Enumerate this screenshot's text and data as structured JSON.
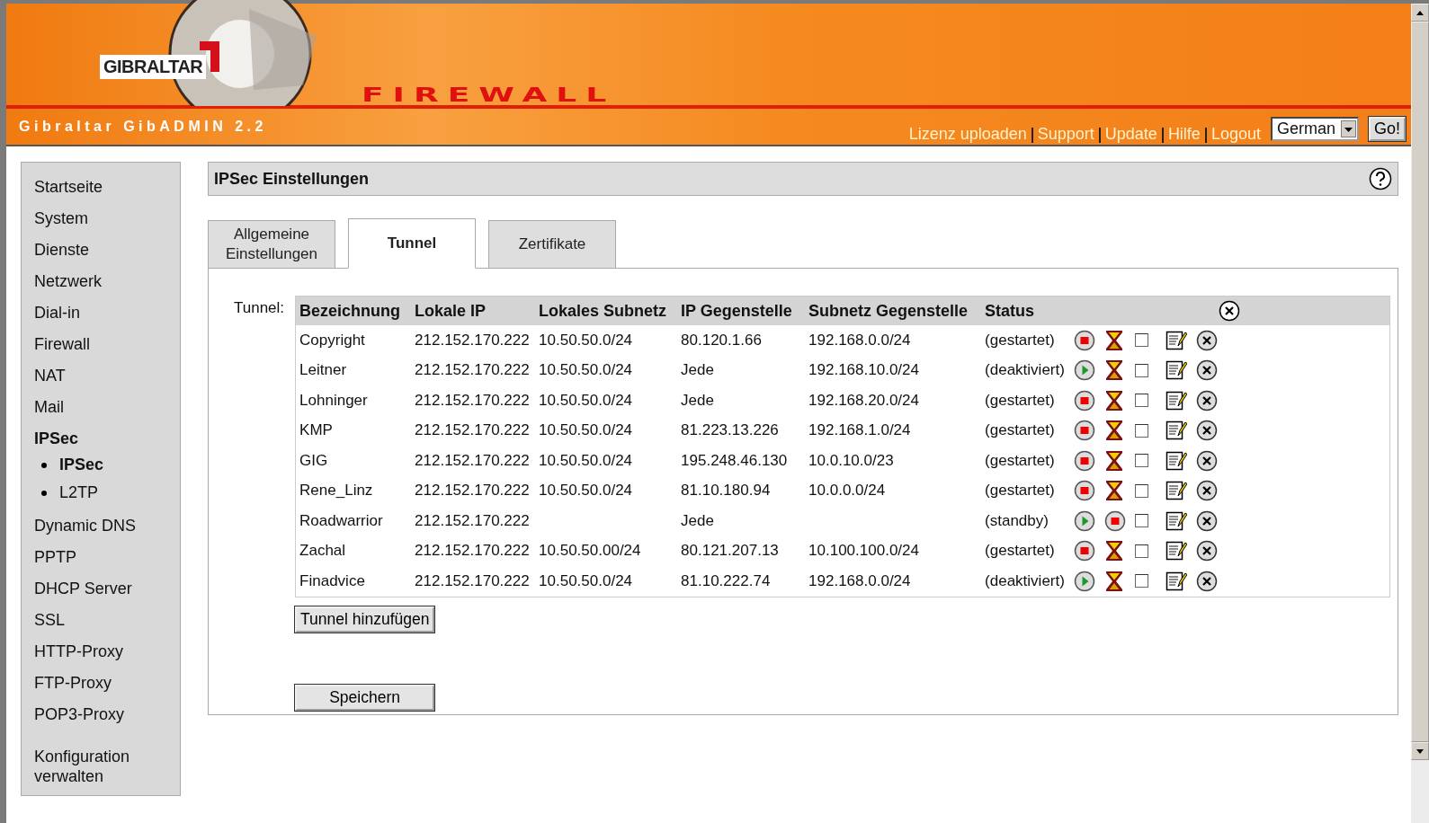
{
  "header": {
    "logo_text": "GIBRALTAR",
    "product": "FIREWALL",
    "app_title": "Gibraltar GibADMIN 2.2",
    "links": [
      "Lizenz uploaden",
      "Support",
      "Update",
      "Hilfe",
      "Logout"
    ],
    "language": "German",
    "go_button": "Go!"
  },
  "sidebar": {
    "items": [
      {
        "label": "Startseite",
        "selected": false
      },
      {
        "label": "System",
        "selected": false
      },
      {
        "label": "Dienste",
        "selected": false
      },
      {
        "label": "Netzwerk",
        "selected": false
      },
      {
        "label": "Dial-in",
        "selected": false
      },
      {
        "label": "Firewall",
        "selected": false
      },
      {
        "label": "NAT",
        "selected": false
      },
      {
        "label": "Mail",
        "selected": false
      },
      {
        "label": "IPSec",
        "selected": true,
        "children": [
          {
            "label": "IPSec",
            "selected": true
          },
          {
            "label": "L2TP",
            "selected": false
          }
        ]
      },
      {
        "label": "Dynamic DNS",
        "selected": false
      },
      {
        "label": "PPTP",
        "selected": false
      },
      {
        "label": "DHCP Server",
        "selected": false
      },
      {
        "label": "SSL",
        "selected": false
      },
      {
        "label": "HTTP-Proxy",
        "selected": false
      },
      {
        "label": "FTP-Proxy",
        "selected": false
      },
      {
        "label": "POP3-Proxy",
        "selected": false
      }
    ],
    "footer_link": "Konfiguration verwalten"
  },
  "panel": {
    "title": "IPSec Einstellungen",
    "tabs": [
      {
        "label": "Allgemeine Einstellungen",
        "selected": false
      },
      {
        "label": "Tunnel",
        "selected": true
      },
      {
        "label": "Zertifikate",
        "selected": false
      }
    ],
    "table_label": "Tunnel:",
    "table": {
      "columns": [
        "Bezeichnung",
        "Lokale IP",
        "Lokales Subnetz",
        "IP Gegenstelle",
        "Subnetz Gegenstelle",
        "Status"
      ],
      "rows": [
        {
          "cells": [
            "Copyright",
            "212.152.170.222",
            "10.50.50.0/24",
            "80.120.1.66",
            "192.168.0.0/24",
            "(gestartet)"
          ],
          "actions": [
            {
              "kind": "stop"
            },
            {
              "kind": "timer"
            }
          ],
          "checked": false
        },
        {
          "cells": [
            "Leitner",
            "212.152.170.222",
            "10.50.50.0/24",
            "Jede",
            "192.168.10.0/24",
            "(deaktiviert)"
          ],
          "actions": [
            {
              "kind": "start"
            },
            {
              "kind": "timer"
            }
          ],
          "checked": false
        },
        {
          "cells": [
            "Lohninger",
            "212.152.170.222",
            "10.50.50.0/24",
            "Jede",
            "192.168.20.0/24",
            "(gestartet)"
          ],
          "actions": [
            {
              "kind": "stop"
            },
            {
              "kind": "timer"
            }
          ],
          "checked": false
        },
        {
          "cells": [
            "KMP",
            "212.152.170.222",
            "10.50.50.0/24",
            "81.223.13.226",
            "192.168.1.0/24",
            "(gestartet)"
          ],
          "actions": [
            {
              "kind": "stop"
            },
            {
              "kind": "timer"
            }
          ],
          "checked": false
        },
        {
          "cells": [
            "GIG",
            "212.152.170.222",
            "10.50.50.0/24",
            "195.248.46.130",
            "10.0.10.0/23",
            "(gestartet)"
          ],
          "actions": [
            {
              "kind": "stop"
            },
            {
              "kind": "timer"
            }
          ],
          "checked": false
        },
        {
          "cells": [
            "Rene_Linz",
            "212.152.170.222",
            "10.50.50.0/24",
            "81.10.180.94",
            "10.0.0.0/24",
            "(gestartet)"
          ],
          "actions": [
            {
              "kind": "stop"
            },
            {
              "kind": "timer"
            }
          ],
          "checked": false
        },
        {
          "cells": [
            "Roadwarrior",
            "212.152.170.222",
            "",
            "Jede",
            "",
            "(standby)"
          ],
          "actions": [
            {
              "kind": "start"
            },
            {
              "kind": "stop"
            }
          ],
          "checked": false
        },
        {
          "cells": [
            "Zachal",
            "212.152.170.222",
            "10.50.50.00/24",
            "80.121.207.13",
            "10.100.100.0/24",
            "(gestartet)"
          ],
          "actions": [
            {
              "kind": "stop"
            },
            {
              "kind": "timer"
            }
          ],
          "checked": false
        },
        {
          "cells": [
            "Finadvice",
            "212.152.170.222",
            "10.50.50.0/24",
            "81.10.222.74",
            "192.168.0.0/24",
            "(deaktiviert)"
          ],
          "actions": [
            {
              "kind": "start"
            },
            {
              "kind": "timer"
            }
          ],
          "checked": false
        }
      ]
    },
    "add_button": "Tunnel hinzufügen",
    "save_button": "Speichern"
  }
}
